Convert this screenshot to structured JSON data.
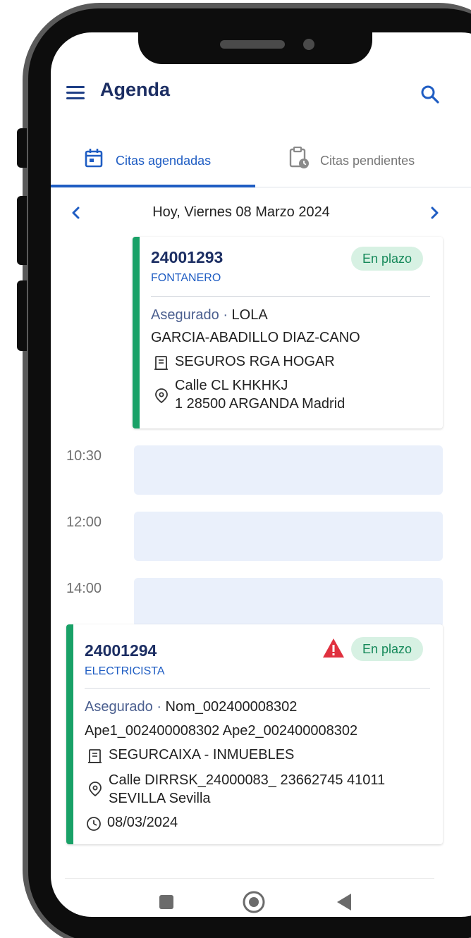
{
  "header": {
    "title": "Agenda",
    "menu_icon": "menu-icon",
    "search_icon": "search-icon"
  },
  "tabs": [
    {
      "label": "Citas agendadas",
      "icon": "calendar-icon",
      "active": true
    },
    {
      "label": "Citas pendientes",
      "icon": "clipboard-clock-icon",
      "active": false
    }
  ],
  "date_nav": {
    "label": "Hoy, Viernes 08 Marzo 2024",
    "prev_icon": "chevron-left-icon",
    "next_icon": "chevron-right-icon"
  },
  "appointments": [
    {
      "number": "24001293",
      "trade": "FONTANERO",
      "status": "En plazo",
      "insured_label": "Asegurado",
      "insured_name_1": "LOLA",
      "insured_name_2": "GARCIA-ABADILLO DIAZ-CANO",
      "insurer": "SEGUROS RGA HOGAR",
      "address_1": "Calle CL KHKHKJ",
      "address_2": "1 28500 ARGANDA Madrid"
    },
    {
      "number": "24001294",
      "trade": "ELECTRICISTA",
      "status": "En plazo",
      "warning_icon": "warning-icon",
      "insured_label": "Asegurado",
      "insured_name_1": "Nom_002400008302",
      "insured_name_2": "Ape1_002400008302 Ape2_002400008302",
      "insurer": "SEGURCAIXA - INMUEBLES",
      "address_1": "Calle DIRRSK_24000083_ 23662745 41011",
      "address_2": "SEVILLA Sevilla",
      "date": "08/03/2024"
    }
  ],
  "time_slots": [
    "10:30",
    "12:00",
    "14:00"
  ],
  "colors": {
    "primary": "#1f5dc3",
    "title": "#1c2e63",
    "accent_green": "#19a167",
    "badge_bg": "#d7f1e3",
    "slot_bg": "#eaf0fb",
    "warning": "#e0313f"
  },
  "system_nav": {
    "recents_icon": "square-icon",
    "home_icon": "home-circle-icon",
    "back_icon": "back-triangle-icon"
  }
}
